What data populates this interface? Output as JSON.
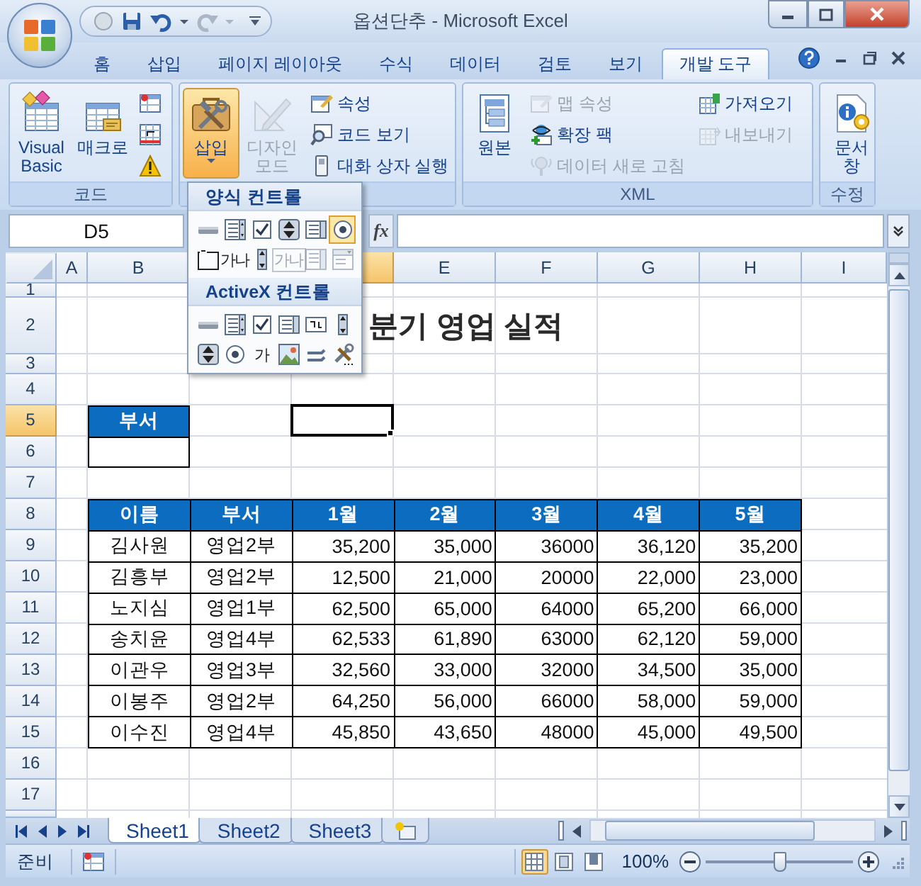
{
  "window": {
    "title": "옵션단추 - Microsoft Excel"
  },
  "ribbon_tabs": [
    {
      "label": "홈",
      "selected": false
    },
    {
      "label": "삽입",
      "selected": false
    },
    {
      "label": "페이지 레이아웃",
      "selected": false
    },
    {
      "label": "수식",
      "selected": false
    },
    {
      "label": "데이터",
      "selected": false
    },
    {
      "label": "검토",
      "selected": false
    },
    {
      "label": "보기",
      "selected": false
    },
    {
      "label": "개발 도구",
      "selected": true
    }
  ],
  "ribbon_groups": [
    {
      "label": "코드",
      "items": [
        {
          "kind": "large",
          "label": "Visual Basic",
          "disabled": false,
          "pressed": false
        },
        {
          "kind": "large",
          "label": "매크로",
          "disabled": false,
          "pressed": false
        },
        {
          "kind": "icon",
          "disabled": false,
          "pressed": false
        },
        {
          "kind": "icon",
          "disabled": false,
          "pressed": false
        },
        {
          "kind": "icon",
          "disabled": false,
          "pressed": false
        }
      ]
    },
    {
      "items": [
        {
          "kind": "dropdown",
          "label": "삽입",
          "disabled": false,
          "pressed": true
        },
        {
          "kind": "large",
          "label": "디자인 모드",
          "disabled": true,
          "pressed": false
        },
        {
          "kind": "small",
          "label": "속성",
          "disabled": false,
          "pressed": false
        },
        {
          "kind": "small",
          "label": "코드 보기",
          "disabled": false,
          "pressed": false
        },
        {
          "kind": "small",
          "label": "대화 상자 실행",
          "disabled": false,
          "pressed": false
        }
      ]
    },
    {
      "label": "XML",
      "items": [
        {
          "kind": "large",
          "label": "원본",
          "disabled": false,
          "pressed": false
        },
        {
          "kind": "small",
          "label": "맵 속성",
          "disabled": true,
          "pressed": false
        },
        {
          "kind": "small",
          "label": "확장 팩",
          "disabled": false,
          "pressed": false
        },
        {
          "kind": "small",
          "label": "데이터 새로 고침",
          "disabled": true,
          "pressed": false
        },
        {
          "kind": "small",
          "label": "가져오기",
          "disabled": false,
          "pressed": false
        },
        {
          "kind": "small",
          "label": "내보내기",
          "disabled": true,
          "pressed": false
        }
      ]
    },
    {
      "label": "수정",
      "items": [
        {
          "kind": "large",
          "label": "문서 창",
          "disabled": false,
          "pressed": false
        }
      ]
    }
  ],
  "formula_bar": {
    "name_box": "D5",
    "function_button": "fx"
  },
  "insert_menu": {
    "sections": [
      {
        "title": "양식 컨트롤",
        "controls": [
          {
            "kind": "button",
            "selected": false,
            "disabled": false
          },
          {
            "kind": "combo",
            "selected": false,
            "disabled": false
          },
          {
            "kind": "checkbox",
            "selected": false,
            "disabled": false
          },
          {
            "kind": "spin",
            "selected": false,
            "disabled": false
          },
          {
            "kind": "listbox",
            "selected": false,
            "disabled": false
          },
          {
            "kind": "option",
            "selected": true,
            "disabled": false
          },
          {
            "kind": "groupbox",
            "selected": false,
            "disabled": false
          },
          {
            "kind": "label",
            "glyph": "가나",
            "selected": false,
            "disabled": false
          },
          {
            "kind": "scrollbar",
            "selected": false,
            "disabled": false
          },
          {
            "kind": "textfield",
            "glyph": "가나",
            "selected": false,
            "disabled": true
          },
          {
            "kind": "combolist",
            "selected": false,
            "disabled": true
          },
          {
            "kind": "combodrop",
            "selected": false,
            "disabled": true
          }
        ]
      },
      {
        "title": "ActiveX 컨트롤",
        "controls": [
          {
            "kind": "button",
            "selected": false,
            "disabled": false
          },
          {
            "kind": "combo",
            "selected": false,
            "disabled": false
          },
          {
            "kind": "checkbox",
            "selected": false,
            "disabled": false
          },
          {
            "kind": "listbox",
            "selected": false,
            "disabled": false
          },
          {
            "kind": "textbox",
            "selected": false,
            "disabled": false
          },
          {
            "kind": "scrollbar",
            "selected": false,
            "disabled": false
          },
          {
            "kind": "spin",
            "selected": false,
            "disabled": false
          },
          {
            "kind": "option",
            "selected": false,
            "disabled": false
          },
          {
            "kind": "label",
            "glyph": "가",
            "selected": false,
            "disabled": false
          },
          {
            "kind": "image",
            "selected": false,
            "disabled": false
          },
          {
            "kind": "toggle",
            "selected": false,
            "disabled": false
          },
          {
            "kind": "more",
            "selected": false,
            "disabled": false
          }
        ]
      }
    ]
  },
  "sheet": {
    "columns": [
      {
        "label": "A",
        "selected": false
      },
      {
        "label": "B",
        "selected": false
      },
      {
        "kind": "covered"
      },
      {
        "kind": "covered",
        "selected": true
      },
      {
        "label": "E",
        "selected": false
      },
      {
        "label": "F",
        "selected": false
      },
      {
        "label": "G",
        "selected": false
      },
      {
        "label": "H",
        "selected": false
      },
      {
        "label": "I",
        "selected": false
      }
    ],
    "rows": [
      {
        "label": "1",
        "selected": false
      },
      {
        "label": "2",
        "selected": false
      },
      {
        "label": "3",
        "selected": false
      },
      {
        "label": "4",
        "selected": false
      },
      {
        "label": "5",
        "selected": true
      },
      {
        "label": "6",
        "selected": false
      },
      {
        "label": "7",
        "selected": false
      },
      {
        "label": "8",
        "selected": false
      },
      {
        "label": "9",
        "selected": false
      },
      {
        "label": "10",
        "selected": false
      },
      {
        "label": "11",
        "selected": false
      },
      {
        "label": "12",
        "selected": false
      },
      {
        "label": "13",
        "selected": false
      },
      {
        "label": "14",
        "selected": false
      },
      {
        "label": "15",
        "selected": false
      },
      {
        "label": "16",
        "selected": false
      },
      {
        "label": "17",
        "selected": false
      }
    ],
    "title": "분기 영업 실적",
    "dept_filter": {
      "header": "부서"
    },
    "table": {
      "columns": [
        "이름",
        "부서",
        "1월",
        "2월",
        "3월",
        "4월",
        "5월"
      ],
      "rows": [
        [
          "김사원",
          "영업2부",
          "35,200",
          "35,000",
          "36000",
          "36,120",
          "35,200"
        ],
        [
          "김흥부",
          "영업2부",
          "12,500",
          "21,000",
          "20000",
          "22,000",
          "23,000"
        ],
        [
          "노지심",
          "영업1부",
          "62,500",
          "65,000",
          "64000",
          "65,200",
          "66,000"
        ],
        [
          "송치윤",
          "영업4부",
          "62,533",
          "61,890",
          "63000",
          "62,120",
          "59,000"
        ],
        [
          "이관우",
          "영업3부",
          "32,560",
          "33,000",
          "32000",
          "34,500",
          "35,000"
        ],
        [
          "이봉주",
          "영업2부",
          "64,250",
          "56,000",
          "66000",
          "58,000",
          "59,000"
        ],
        [
          "이수진",
          "영업4부",
          "45,850",
          "43,650",
          "48000",
          "45,000",
          "49,500"
        ]
      ]
    }
  },
  "sheet_tabs": [
    {
      "label": "Sheet1",
      "selected": true
    },
    {
      "label": "Sheet2",
      "selected": false
    },
    {
      "label": "Sheet3",
      "selected": false
    }
  ],
  "status_bar": {
    "mode": "준비",
    "views": [
      {
        "kind": "normal",
        "selected": true
      },
      {
        "kind": "page_layout",
        "selected": false
      },
      {
        "kind": "page_break",
        "selected": false
      }
    ],
    "zoom": "100%",
    "zoom_slider": {
      "level": 0.5
    }
  }
}
